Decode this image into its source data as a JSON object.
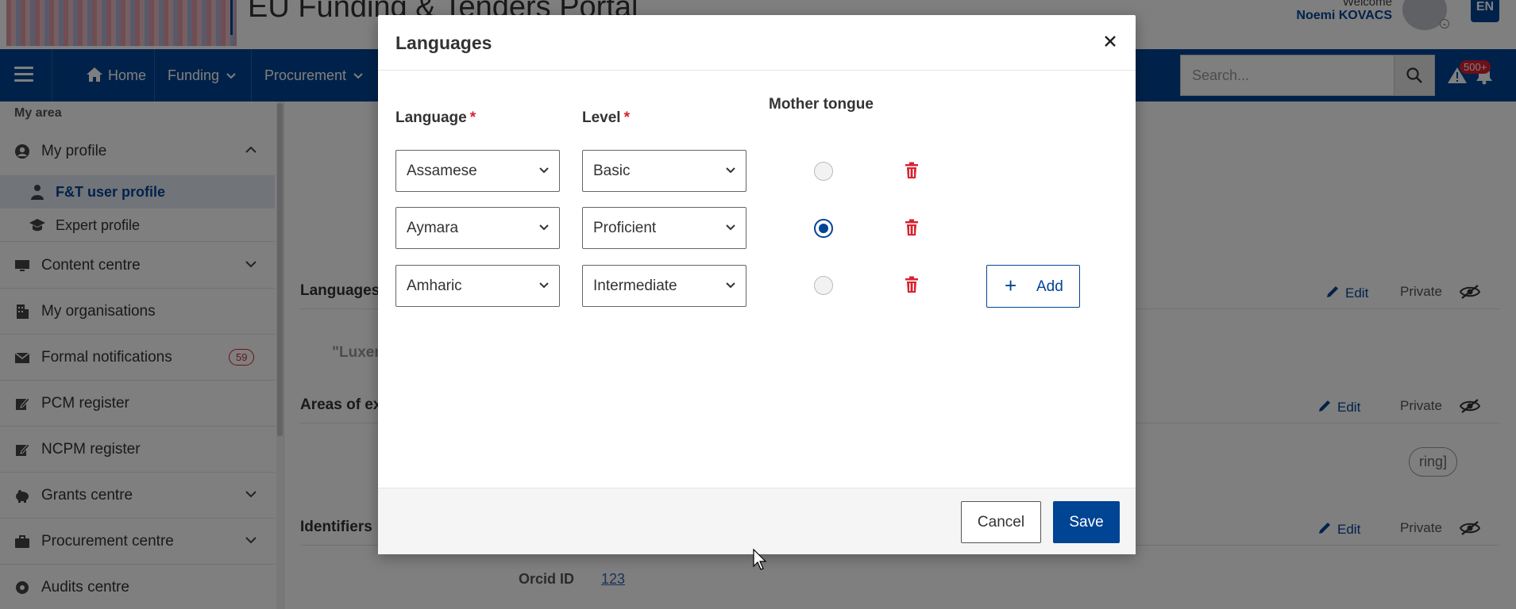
{
  "header": {
    "portal_title": "EU Funding & Tenders Portal",
    "welcome": "Welcome",
    "user_name": "Noemi KOVACS",
    "language_code": "EN"
  },
  "navbar": {
    "items": [
      {
        "label": "Home"
      },
      {
        "label": "Funding"
      },
      {
        "label": "Procurement"
      }
    ],
    "search_placeholder": "Search...",
    "notification_count": "500+"
  },
  "sidebar": {
    "section_label": "My area",
    "my_profile": "My profile",
    "sub_items": [
      {
        "label": "F&T user profile",
        "active": true
      },
      {
        "label": "Expert profile"
      }
    ],
    "items": [
      {
        "label": "Content centre"
      },
      {
        "label": "My organisations"
      },
      {
        "label": "Formal notifications",
        "badge": "59"
      },
      {
        "label": "PCM register"
      },
      {
        "label": "NCPM register"
      },
      {
        "label": "Grants centre"
      },
      {
        "label": "Procurement centre"
      },
      {
        "label": "Audits centre"
      }
    ]
  },
  "main": {
    "sections": [
      {
        "title": "Languages",
        "edit": "Edit",
        "visibility": "Private"
      },
      {
        "title": "Areas of ex",
        "edit": "Edit",
        "visibility": "Private"
      },
      {
        "title": "Identifiers",
        "edit": "Edit",
        "visibility": "Private"
      }
    ],
    "languages_preview": "\"Luxer",
    "areas_chip": "ring]",
    "orcid_label": "Orcid ID",
    "orcid_value": "123"
  },
  "modal": {
    "title": "Languages",
    "columns": {
      "language": "Language",
      "level": "Level",
      "mother_tongue": "Mother tongue",
      "required_marker": "*"
    },
    "rows": [
      {
        "language": "Assamese",
        "level": "Basic",
        "mother_tongue": false
      },
      {
        "language": "Aymara",
        "level": "Proficient",
        "mother_tongue": true
      },
      {
        "language": "Amharic",
        "level": "Intermediate",
        "mother_tongue": false
      }
    ],
    "add_label": "Add",
    "cancel_label": "Cancel",
    "save_label": "Save"
  },
  "colors": {
    "primary": "#004494",
    "danger": "#da2131"
  }
}
